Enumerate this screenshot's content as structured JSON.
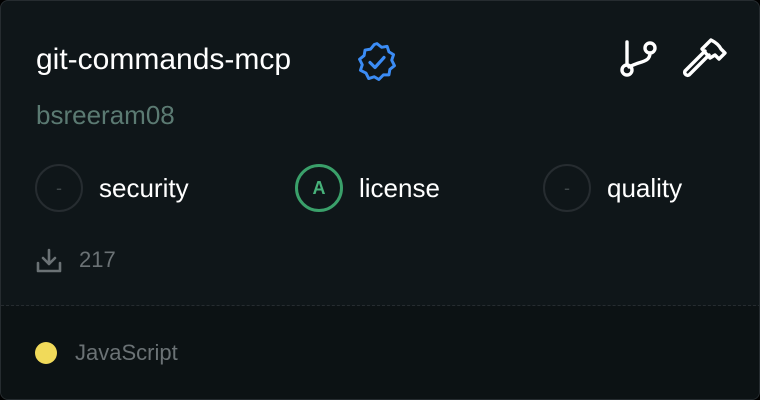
{
  "server": {
    "name": "git-commands-mcp",
    "author": "bsreeram08",
    "verified_icon": "verified-badge-icon",
    "actions": [
      {
        "icon": "git-branch-icon"
      },
      {
        "icon": "hammer-icon"
      }
    ]
  },
  "metrics": [
    {
      "grade": "-",
      "label": "security"
    },
    {
      "grade": "A",
      "label": "license"
    },
    {
      "grade": "-",
      "label": "quality"
    }
  ],
  "downloads": {
    "icon": "download-icon",
    "count": "217"
  },
  "language": {
    "name": "JavaScript",
    "color": "#f1da5a"
  },
  "colors": {
    "accent_blue": "#3b8cf5",
    "grade_good": "#3aa06a",
    "card_bg": "#0f1619",
    "muted_text": "#6b7275"
  }
}
